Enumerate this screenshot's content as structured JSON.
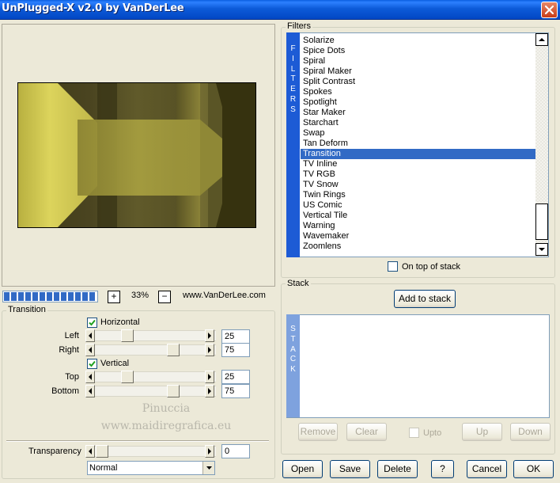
{
  "window": {
    "title": "UnPlugged-X v2.0 by VanDerLee",
    "close_icon": "close-icon"
  },
  "toolbar": {
    "zoom_in_label": "+",
    "zoom_value": "33%",
    "zoom_out_label": "−",
    "website": "www.VanDerLee.com",
    "progress_segments": 13
  },
  "transition_panel": {
    "title": "Transition",
    "horizontal_label": "Horizontal",
    "horizontal_checked": true,
    "vertical_label": "Vertical",
    "vertical_checked": true,
    "sliders": [
      {
        "label": "Left",
        "value": "25"
      },
      {
        "label": "Right",
        "value": "75"
      },
      {
        "label": "Top",
        "value": "25"
      },
      {
        "label": "Bottom",
        "value": "75"
      }
    ],
    "transparency_label": "Transparency",
    "transparency_value": "0",
    "blend_mode": "Normal"
  },
  "watermark": {
    "line1": "Pinuccia",
    "line2": "www.maidiregrafica.eu"
  },
  "filters": {
    "title": "Filters",
    "strip_letters": [
      "F",
      "I",
      "L",
      "T",
      "E",
      "R",
      "S"
    ],
    "items": [
      "Solarize",
      "Spice Dots",
      "Spiral",
      "Spiral Maker",
      "Split Contrast",
      "Spokes",
      "Spotlight",
      "Star Maker",
      "Starchart",
      "Swap",
      "Tan Deform",
      "Transition",
      "TV Inline",
      "TV RGB",
      "TV Snow",
      "Twin Rings",
      "US Comic",
      "Vertical Tile",
      "Warning",
      "Wavemaker",
      "Zoomlens"
    ],
    "selected": "Transition",
    "on_top_label": "On top of stack"
  },
  "stack": {
    "title": "Stack",
    "add_button": "Add to stack",
    "strip_letters": [
      "S",
      "T",
      "A",
      "C",
      "K"
    ],
    "remove_button": "Remove",
    "clear_button": "Clear",
    "upto_label": "Upto",
    "up_button": "Up",
    "down_button": "Down"
  },
  "footer_buttons": {
    "open": "Open",
    "save": "Save",
    "delete": "Delete",
    "help": "?",
    "cancel": "Cancel",
    "ok": "OK"
  },
  "colors": {
    "title_bar": "#0147c4",
    "selection": "#316ac5",
    "filters_strip": "#1d5bd5",
    "stack_strip": "#7ea2de",
    "preview_dark": "#3e3a18",
    "preview_yellow": "#d8d056"
  }
}
